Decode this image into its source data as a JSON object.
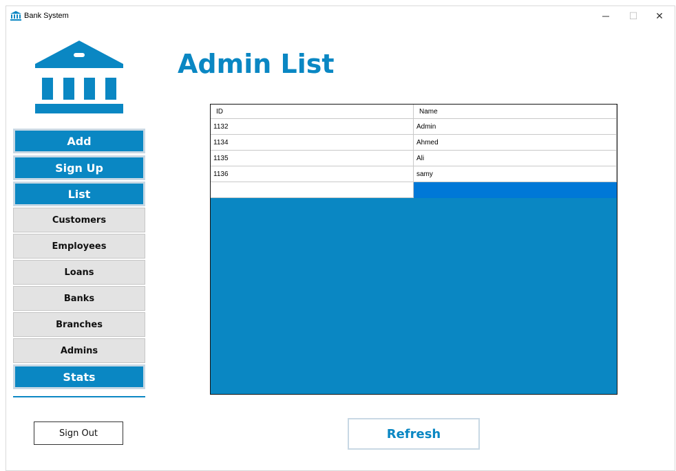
{
  "window": {
    "title": "Bank System",
    "minimize_glyph": "─",
    "maximize_glyph": "☐",
    "close_glyph": "✕"
  },
  "colors": {
    "accent": "#0a87c3",
    "selection": "#0078d7"
  },
  "page": {
    "title": "Admin List"
  },
  "sidebar": {
    "logo_icon": "bank-icon",
    "items": [
      {
        "label": "Add",
        "style": "primary"
      },
      {
        "label": "Sign Up",
        "style": "primary"
      },
      {
        "label": "List",
        "style": "primary"
      },
      {
        "label": "Customers",
        "style": "secondary"
      },
      {
        "label": "Employees",
        "style": "secondary"
      },
      {
        "label": "Loans",
        "style": "secondary"
      },
      {
        "label": "Banks",
        "style": "secondary"
      },
      {
        "label": "Branches",
        "style": "secondary"
      },
      {
        "label": "Admins",
        "style": "secondary"
      },
      {
        "label": "Stats",
        "style": "primary"
      }
    ],
    "sign_out_label": "Sign Out"
  },
  "table": {
    "columns": [
      "ID",
      "Name"
    ],
    "rows": [
      [
        "1132",
        "Admin"
      ],
      [
        "1134",
        "Ahmed"
      ],
      [
        "1135",
        "Ali"
      ],
      [
        "1136",
        "samy"
      ]
    ]
  },
  "refresh_label": "Refresh"
}
